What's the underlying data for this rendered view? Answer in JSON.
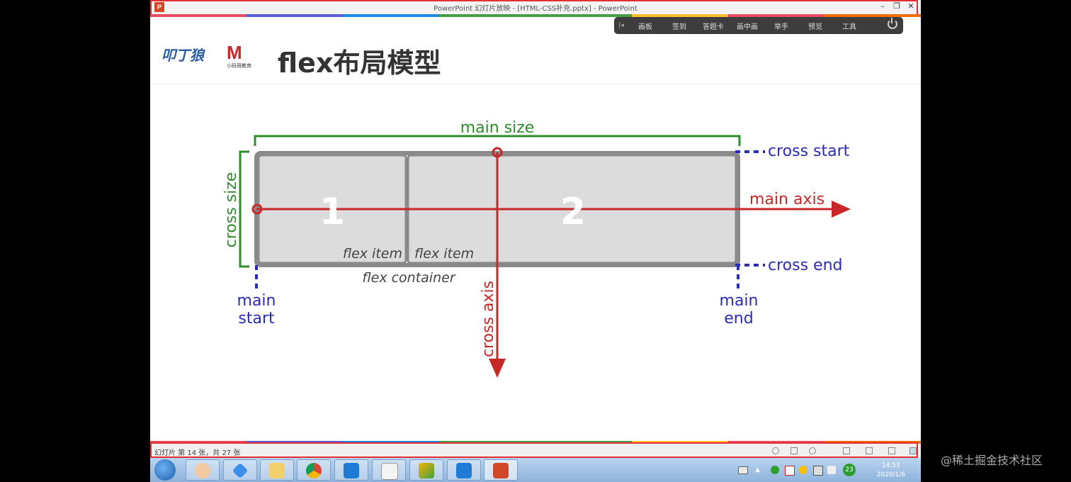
{
  "window": {
    "app_icon": "P",
    "title": "PowerPoint 幻灯片放映 - [HTML-CSS补充.pptx] - PowerPoint",
    "minimize": "–",
    "restore": "❐",
    "close": "✕"
  },
  "toolbar": {
    "items": [
      "画板",
      "签到",
      "答题卡",
      "画中画",
      "举手",
      "预览",
      "工具"
    ]
  },
  "slide": {
    "logo_text": "叩丁狼",
    "logo2_text": "小码哥教育",
    "title": "flex布局模型",
    "labels": {
      "main_size": "main size",
      "cross_size": "cross size",
      "cross_start": "cross start",
      "cross_end": "cross end",
      "main_axis": "main axis",
      "cross_axis": "cross axis",
      "main_start_1": "main",
      "main_start_2": "start",
      "main_end_1": "main",
      "main_end_2": "end",
      "item1_num": "1",
      "item2_num": "2",
      "item1_label": "flex item",
      "item2_label": "flex item",
      "container_label": "flex container"
    },
    "colors": {
      "green": "#2e8b2e",
      "red": "#c62828",
      "blue": "#2b2bb3",
      "gray": "#8a8a8a",
      "item_fill": "#dcdcdc"
    }
  },
  "statusbar": {
    "text": "幻灯片 第 14 张，共 27 张"
  },
  "taskbar": {
    "apps": [
      "user-app",
      "feishu",
      "file-explorer",
      "chrome",
      "vscode",
      "typora",
      "gallery",
      "vscode",
      "powerpoint"
    ],
    "tray_badge": "23",
    "time": "14:53",
    "date": "2020/1/6"
  },
  "watermark": "@稀土掘金技术社区"
}
